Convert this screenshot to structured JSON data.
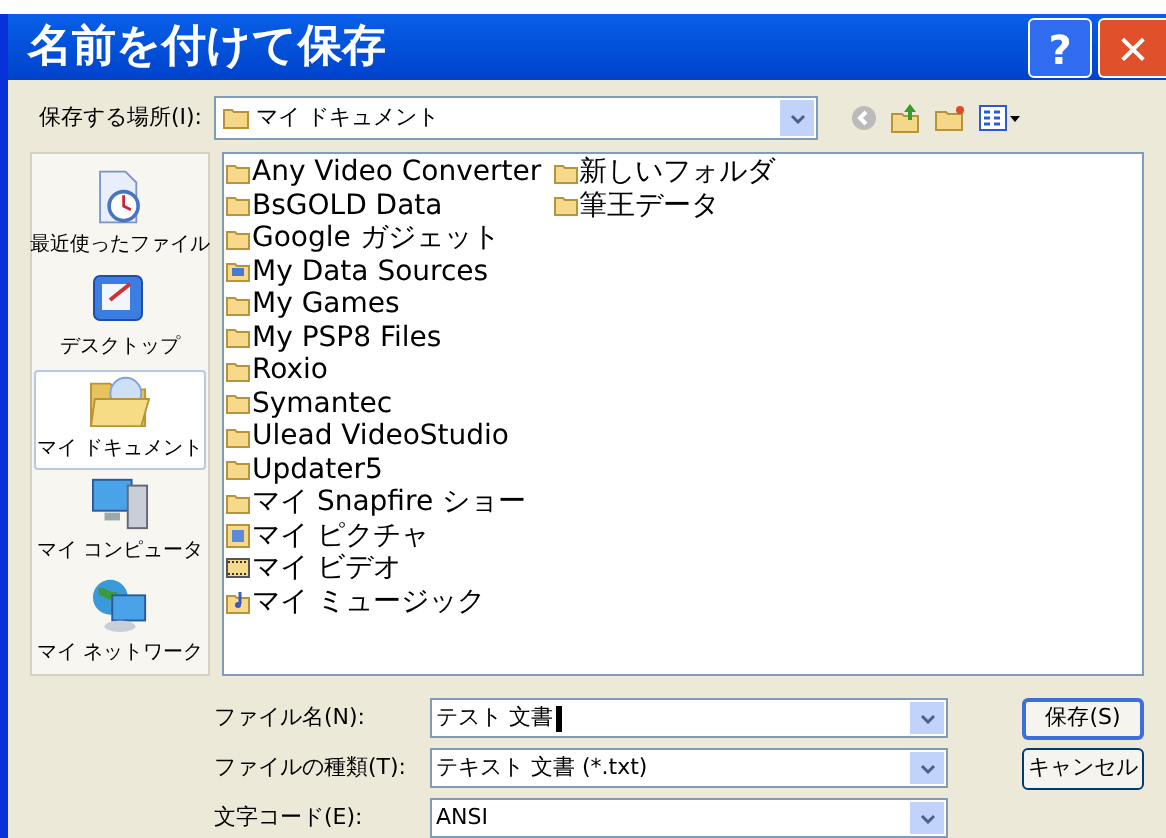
{
  "window": {
    "title": "名前を付けて保存",
    "help_button": "?",
    "close_button": "✕"
  },
  "location": {
    "label": "保存する場所(I):",
    "value": "マイ ドキュメント"
  },
  "places": [
    {
      "label": "最近使ったファイル",
      "kind": "recent",
      "selected": false
    },
    {
      "label": "デスクトップ",
      "kind": "desktop",
      "selected": false
    },
    {
      "label": "マイ ドキュメント",
      "kind": "documents",
      "selected": true
    },
    {
      "label": "マイ コンピュータ",
      "kind": "computer",
      "selected": false
    },
    {
      "label": "マイ ネットワーク",
      "kind": "network",
      "selected": false
    }
  ],
  "files": [
    [
      {
        "name": "Any Video Converter",
        "kind": "folder"
      },
      {
        "name": "BsGOLD Data",
        "kind": "folder"
      },
      {
        "name": "Google ガジェット",
        "kind": "folder"
      },
      {
        "name": "My Data Sources",
        "kind": "datasource"
      },
      {
        "name": "My Games",
        "kind": "folder"
      },
      {
        "name": "My PSP8 Files",
        "kind": "folder"
      },
      {
        "name": "Roxio",
        "kind": "folder"
      },
      {
        "name": "Symantec",
        "kind": "folder"
      },
      {
        "name": "Ulead VideoStudio",
        "kind": "folder"
      },
      {
        "name": "Updater5",
        "kind": "folder"
      },
      {
        "name": "マイ Snapfire ショー",
        "kind": "folder"
      },
      {
        "name": "マイ ピクチャ",
        "kind": "pictures"
      },
      {
        "name": "マイ ビデオ",
        "kind": "videos"
      },
      {
        "name": "マイ ミュージック",
        "kind": "music"
      }
    ],
    [
      {
        "name": "新しいフォルダ",
        "kind": "folder"
      },
      {
        "name": "筆王データ",
        "kind": "folder"
      }
    ]
  ],
  "fields": [
    {
      "label": "ファイル名(N):",
      "value": "テスト 文書",
      "focused": true
    },
    {
      "label": "ファイルの種類(T):",
      "value": "テキスト 文書 (*.txt)",
      "focused": false
    },
    {
      "label": "文字コード(E):",
      "value": "ANSI",
      "focused": false
    }
  ],
  "buttons": [
    {
      "label": "保存(S)",
      "default": true
    },
    {
      "label": "キャンセル",
      "default": false
    }
  ]
}
